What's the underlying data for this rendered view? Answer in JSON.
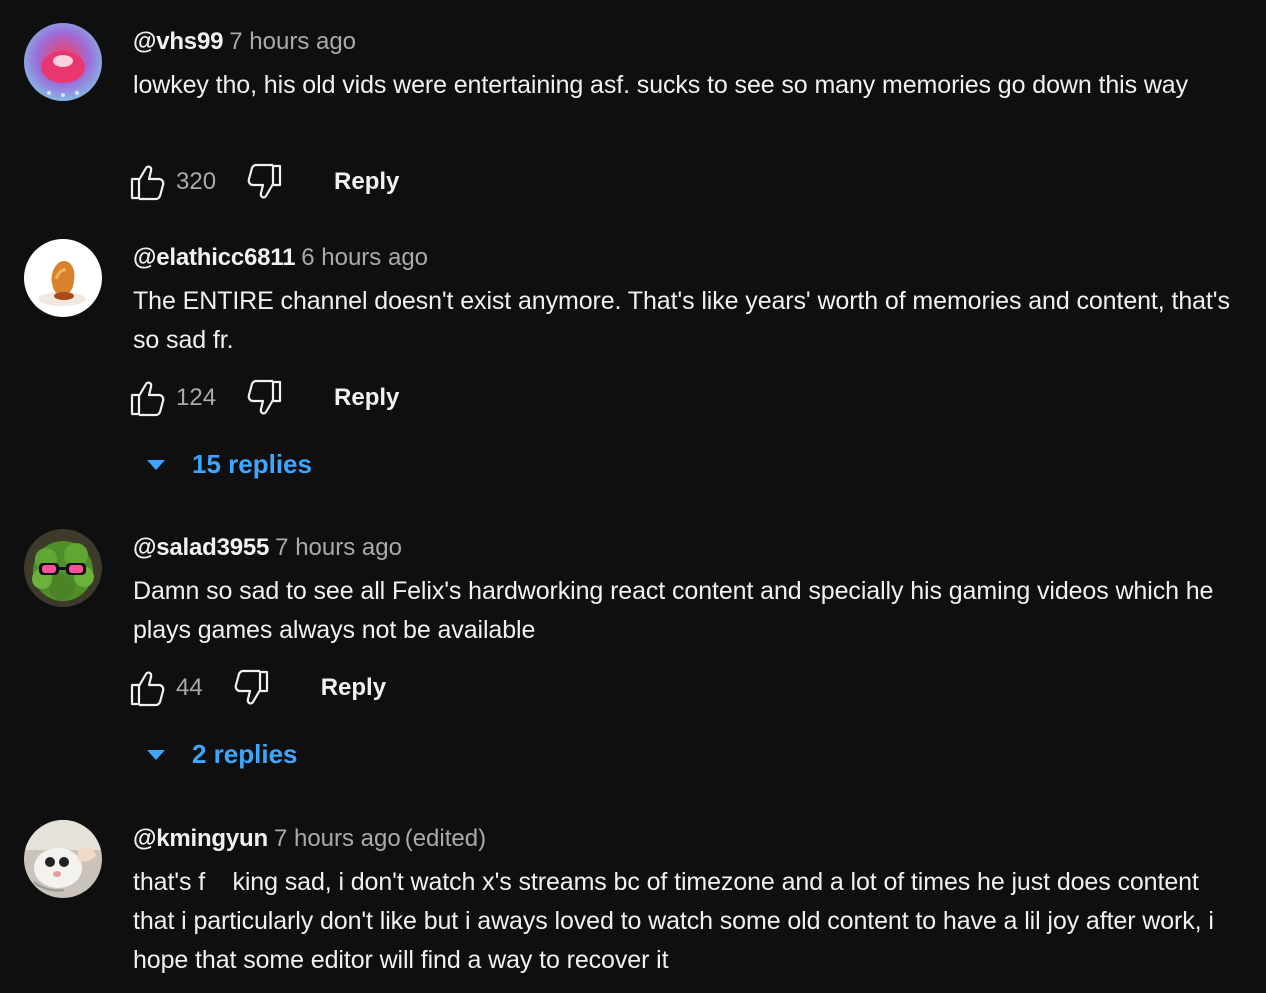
{
  "comments": [
    {
      "author": "@vhs99",
      "time": "7 hours ago",
      "edited": "",
      "text": "lowkey tho, his old vids were entertaining asf. sucks to see so many memories go down this way",
      "likes": "320",
      "reply_label": "Reply",
      "replies_label": ""
    },
    {
      "author": "@elathicc6811",
      "time": "6 hours ago",
      "edited": "",
      "text": "The ENTIRE channel doesn't exist anymore. That's like years' worth of memories and content, that's so sad fr.",
      "likes": "124",
      "reply_label": "Reply",
      "replies_label": "15 replies"
    },
    {
      "author": "@salad3955",
      "time": "7 hours ago",
      "edited": "",
      "text": "Damn so sad to see all Felix's hardworking react content and specially his gaming videos which he plays games always not be available",
      "likes": "44",
      "reply_label": "Reply",
      "replies_label": "2 replies"
    },
    {
      "author": "@kmingyun",
      "time": "7 hours ago",
      "edited": "(edited)",
      "text": "that's f    king sad, i don't watch x's streams bc of timezone and a lot of times he just does content that i particularly don't like but i aways loved to watch some old content to have a lil joy after work, i hope that some editor will find a way to recover it",
      "likes": "",
      "reply_label": "",
      "replies_label": ""
    }
  ],
  "icons": {
    "like": "thumbs-up-icon",
    "dislike": "thumbs-down-icon",
    "expand": "caret-down-icon"
  },
  "colors": {
    "background": "#0f0f0f",
    "text": "#f1f1f1",
    "muted": "#aaaaaa",
    "link": "#3ea6ff"
  }
}
